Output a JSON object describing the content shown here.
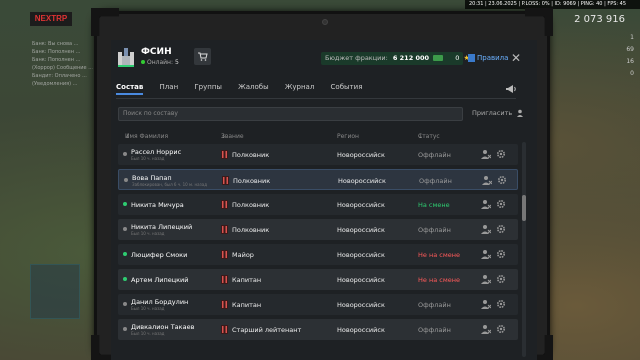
{
  "hud": {
    "topbar": "20:31 | 23.06.2025 | P.LOSS: 0% | ID: 9069 | PING: 40 | FPS: 45",
    "game_logo": "NEXTRP",
    "money": "2 073 916",
    "chat": [
      "Банк: Вы снова ...",
      "Банк: Пополнен ...",
      "Банк: Пополнен ...",
      "(Хоррор) Сообщение ...",
      "Бандит: Оплачено ...",
      "(Уведомления) ..."
    ],
    "right_values": [
      "1",
      "69",
      "16",
      "0"
    ]
  },
  "header": {
    "faction_name": "ФСИН",
    "online_label": "Онлайн:",
    "online_count": "5",
    "budget_label": "Бюджет фракции:",
    "budget_amount": "6 212 000",
    "points": "0",
    "rules_label": "Правила",
    "close_symbol": "✕"
  },
  "tabs": [
    {
      "label": "Состав",
      "active": true
    },
    {
      "label": "План",
      "active": false
    },
    {
      "label": "Группы",
      "active": false
    },
    {
      "label": "Жалобы",
      "active": false
    },
    {
      "label": "Журнал",
      "active": false
    },
    {
      "label": "События",
      "active": false
    }
  ],
  "search": {
    "placeholder": "Поиск по составу"
  },
  "invite_label": "Пригласить",
  "table": {
    "headers": {
      "name": "Имя Фамилия",
      "rank": "Звание",
      "region": "Регион",
      "status": "Статус"
    },
    "rows": [
      {
        "name": "Рассел Норрис",
        "sub": "Был 10 ч. назад",
        "online": false,
        "rank": "Полковник",
        "region": "Новороссийск",
        "status": "Оффлайн",
        "status_kind": "off"
      },
      {
        "name": "Вова Папап",
        "sub": "Заблокирован, был 6 ч. 10 м. назад",
        "online": false,
        "rank": "Полковник",
        "region": "Новороссийск",
        "status": "Оффлайн",
        "status_kind": "off",
        "highlight": true
      },
      {
        "name": "Никита Мичура",
        "sub": "",
        "online": true,
        "rank": "Полковник",
        "region": "Новороссийск",
        "status": "На смене",
        "status_kind": "on"
      },
      {
        "name": "Никита Липецкий",
        "sub": "Был 10 ч. назад",
        "online": false,
        "rank": "Полковник",
        "region": "Новороссийск",
        "status": "Оффлайн",
        "status_kind": "off"
      },
      {
        "name": "Люцифер Смоки",
        "sub": "",
        "online": true,
        "rank": "Майор",
        "region": "Новороссийск",
        "status": "Не на смене",
        "status_kind": "red"
      },
      {
        "name": "Артем Липецкий",
        "sub": "",
        "online": true,
        "rank": "Капитан",
        "region": "Новороссийск",
        "status": "Не на смене",
        "status_kind": "red"
      },
      {
        "name": "Данил Бордулин",
        "sub": "Был 10 ч. назад",
        "online": false,
        "rank": "Капитан",
        "region": "Новороссийск",
        "status": "Оффлайн",
        "status_kind": "off"
      },
      {
        "name": "Дивкалион Такаев",
        "sub": "Был 10 ч. назад",
        "online": false,
        "rank": "Старший лейтенант",
        "region": "Новороссийск",
        "status": "Оффлайн",
        "status_kind": "off"
      }
    ]
  },
  "colors": {
    "accent": "#4a8ae0",
    "online": "#2ecc71",
    "offduty": "#ff5a5a",
    "rank_icon": "#d9534f"
  }
}
